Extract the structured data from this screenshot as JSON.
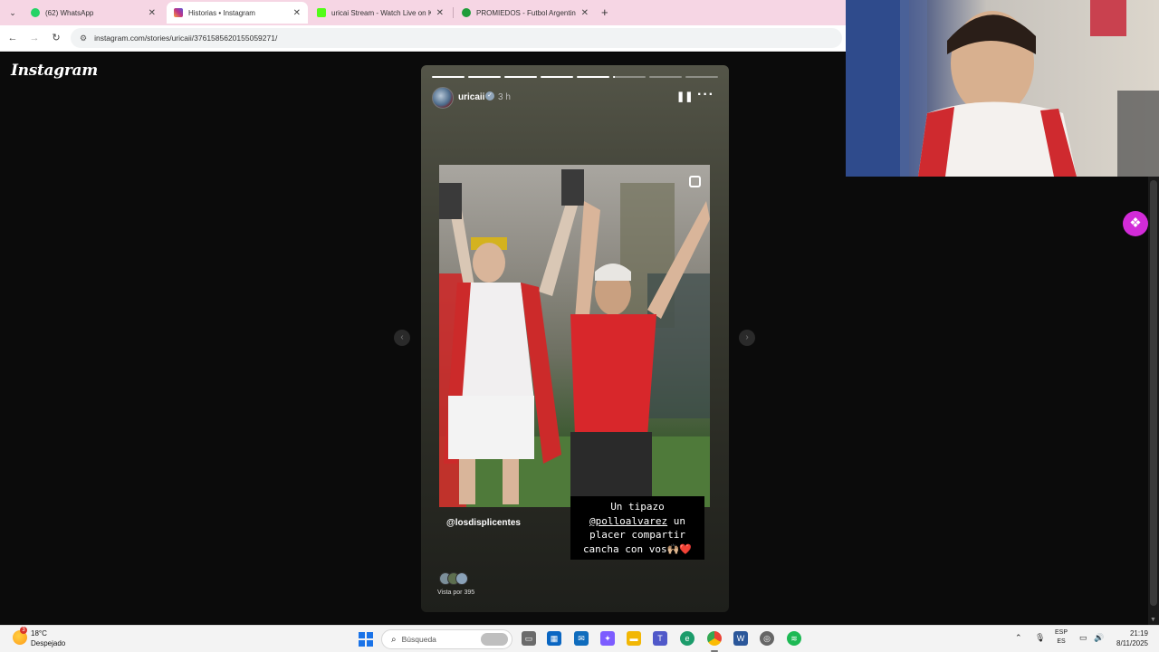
{
  "browser": {
    "tabs": [
      {
        "title": "(62) WhatsApp",
        "active": false,
        "favicon_color": "#25d366"
      },
      {
        "title": "Historias • Instagram",
        "active": true,
        "favicon_color": "#c13584"
      },
      {
        "title": "uricai Stream - Watch Live on K",
        "active": false,
        "favicon_color": "#53fc18"
      },
      {
        "title": "PROMIEDOS - Futbol Argentin",
        "active": false,
        "favicon_color": "#1f9d3a"
      }
    ],
    "url": "instagram.com/stories/uricaii/3761585620155059271/"
  },
  "instagram": {
    "logo": "Instagram",
    "story": {
      "username": "uricaii",
      "time_ago": "3 h",
      "progress_segments": [
        1,
        1,
        1,
        1,
        1,
        0.05,
        0,
        0
      ],
      "mention_tag": "@losdisplicentes",
      "caption_line1": "Un tipazo",
      "caption_mention": "@polloalvarez",
      "caption_line2": "un",
      "caption_line3": "placer compartir",
      "caption_line4": "cancha con vos🙌🏼❤️",
      "viewed_by": "Vista por 395"
    }
  },
  "taskbar": {
    "weather_temp": "18°C",
    "weather_desc": "Despejado",
    "weather_badge": "3",
    "search_placeholder": "Búsqueda",
    "lang_top": "ESP",
    "lang_bottom": "ES",
    "time": "21:19",
    "date": "8/11/2025"
  },
  "colors": {
    "instagram_bg": "#0b0b0b",
    "tabbar": "#f6d6e4",
    "overlay_badge": "#d22bd8"
  }
}
